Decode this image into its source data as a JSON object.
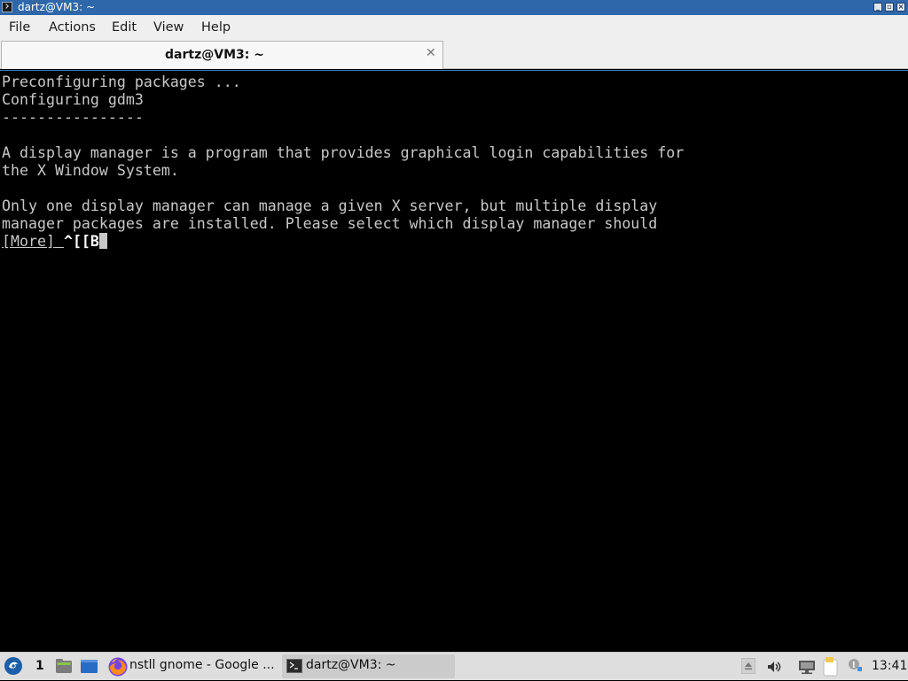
{
  "window": {
    "title": "dartz@VM3: ~",
    "controls": [
      "minimize",
      "maximize",
      "close"
    ]
  },
  "menubar": {
    "items": [
      "File",
      "Actions",
      "Edit",
      "View",
      "Help"
    ]
  },
  "tabs": [
    {
      "label": "dartz@VM3: ~",
      "close_icon": "close-icon"
    }
  ],
  "terminal": {
    "lines": [
      "Preconfiguring packages ...",
      "Configuring gdm3",
      "----------------",
      "",
      "A display manager is a program that provides graphical login capabilities for",
      "the X Window System.",
      "",
      "Only one display manager can manage a given X server, but multiple display",
      "manager packages are installed. Please select which display manager should"
    ],
    "more_prompt": "[More]",
    "typed_input": "^[[B",
    "colors": {
      "background": "#000000",
      "foreground": "#c8c8c8"
    }
  },
  "taskbar": {
    "start_icon": "lubuntu-start-icon",
    "workspace": "1",
    "tasks": [
      {
        "icon": "firefox-icon",
        "label": "nstll gnome - Google ..."
      },
      {
        "icon": "terminal-icon",
        "label": "dartz@VM3: ~"
      }
    ],
    "tray_icons": [
      "eject-icon",
      "volume-icon",
      "network-icon",
      "notes-icon",
      "update-icon"
    ],
    "clock": "13:41"
  },
  "colors": {
    "titlebar": "#2f67ab",
    "taskbar": "#dedede",
    "accent": "#3a7cc3"
  }
}
